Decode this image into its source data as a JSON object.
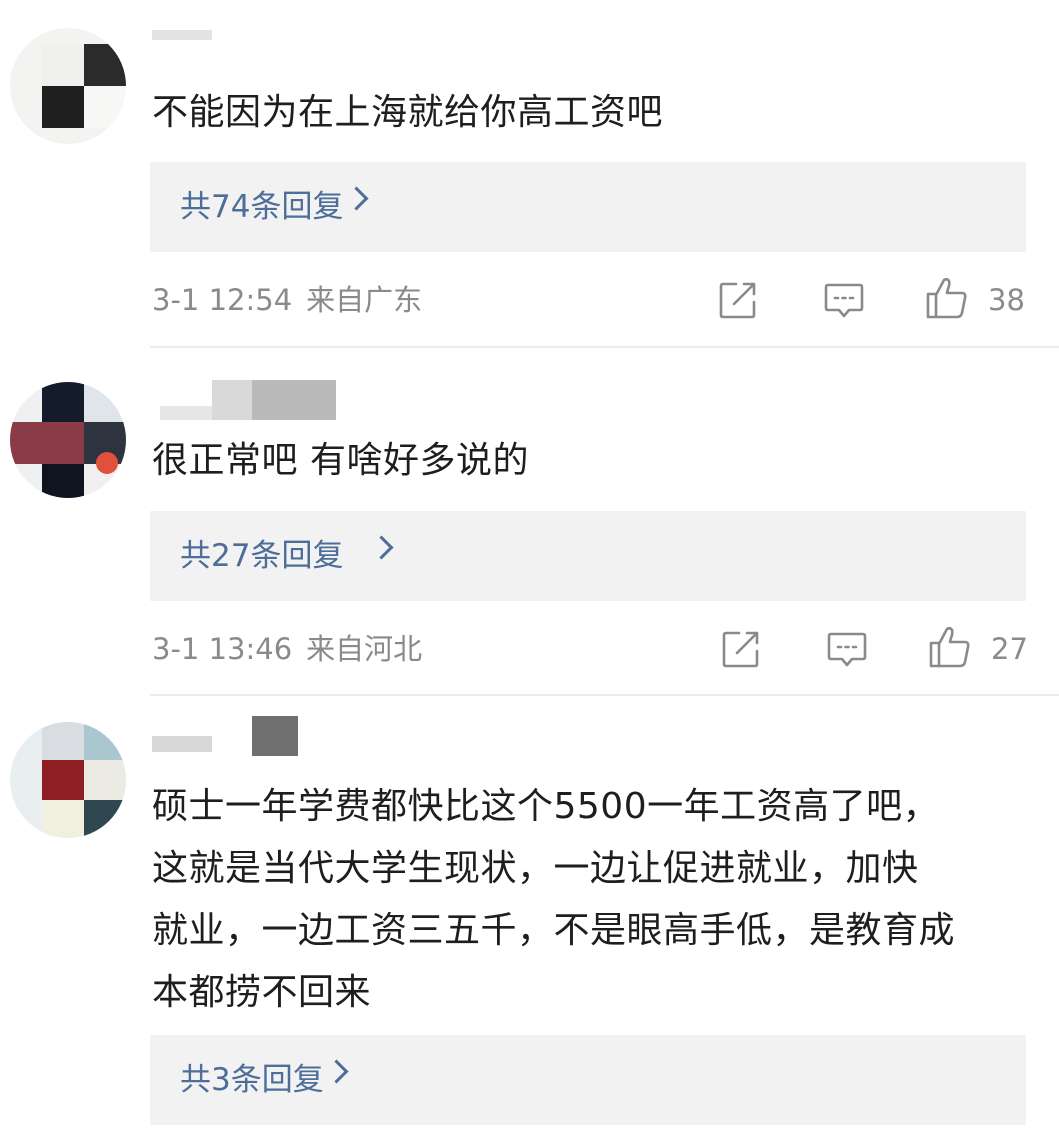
{
  "comments": [
    {
      "content": "不能因为在上海就给你高工资吧",
      "replies_label": "共74条回复",
      "time": "3-1 12:54",
      "location": "来自广东",
      "likes": "38"
    },
    {
      "content": "很正常吧 有啥好多说的",
      "replies_label": "共27条回复",
      "time": "3-1 13:46",
      "location": "来自河北",
      "likes": "27"
    },
    {
      "content": "硕士一年学费都快比这个5500一年工资高了吧，\n这就是当代大学生现状，一边让促进就业，加快\n就业，一边工资三五千，不是眼高手低，是教育成\n本都捞不回来",
      "replies_label": "共3条回复"
    }
  ],
  "icons": {
    "share": "share-icon",
    "reply": "comment-icon",
    "like": "thumbs-up-icon",
    "chevron": "chevron-right-icon"
  },
  "colors": {
    "link": "#4c6e98",
    "meta_text": "#8a8a8a",
    "reply_box_bg": "#f2f2f2"
  }
}
